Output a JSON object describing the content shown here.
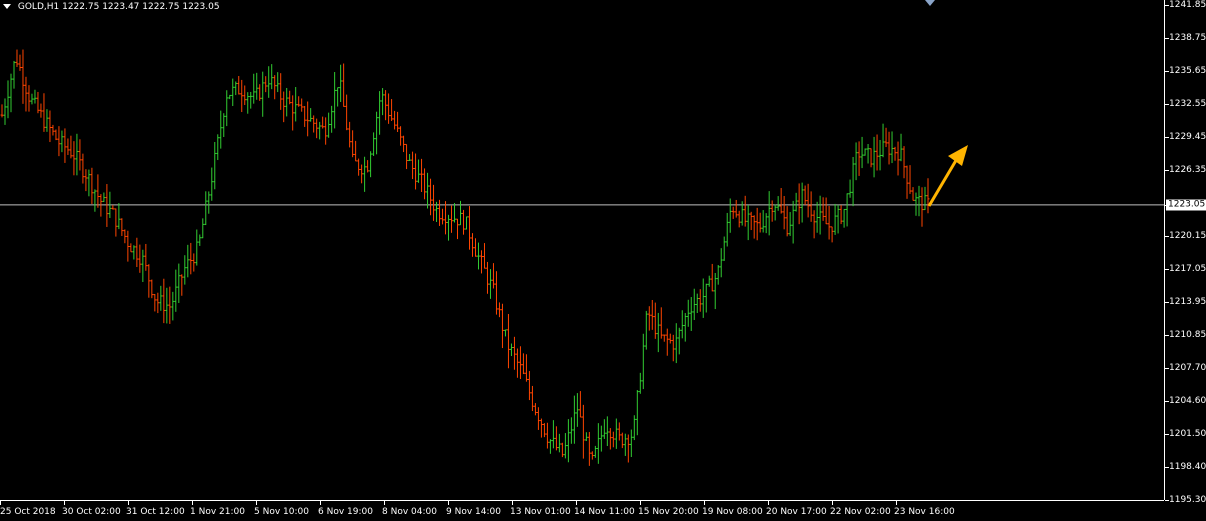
{
  "header": {
    "symbol": "GOLD,H1",
    "ohlc": "1222.75 1223.47 1222.75 1223.05"
  },
  "current_price": "1223.05",
  "colors": {
    "background": "#000000",
    "bull": "#32cd32",
    "bear": "#ff4500",
    "axis": "#ffffff",
    "price_line": "#c0c0c0",
    "arrow": "#ffb400"
  },
  "chart_data": {
    "type": "line",
    "title": "",
    "ylim": [
      1195.3,
      1241.85
    ],
    "y_ticks": [
      "1241.85",
      "1238.75",
      "1235.65",
      "1232.55",
      "1229.45",
      "1226.35",
      "1223.05",
      "1220.15",
      "1217.05",
      "1213.95",
      "1210.85",
      "1207.70",
      "1204.60",
      "1201.50",
      "1198.40",
      "1195.30"
    ],
    "x_ticks": [
      "25 Oct 2018",
      "30 Oct 02:00",
      "31 Oct 12:00",
      "1 Nov 21:00",
      "5 Nov 10:00",
      "6 Nov 19:00",
      "8 Nov 04:00",
      "9 Nov 14:00",
      "13 Nov 01:00",
      "14 Nov 11:00",
      "15 Nov 20:00",
      "19 Nov 08:00",
      "20 Nov 17:00",
      "22 Nov 02:00",
      "23 Nov 16:00"
    ],
    "series": [
      {
        "values": [
          1231.5,
          1237.0,
          1233.0,
          1231.0,
          1229.0,
          1228.0,
          1226.0,
          1223.5,
          1222.0,
          1219.5,
          1218.0,
          1214.0,
          1213.5,
          1217.0,
          1219.0,
          1226.0,
          1233.5,
          1234.0,
          1233.0,
          1235.0,
          1233.0,
          1232.0,
          1231.0,
          1230.0,
          1235.0,
          1227.0,
          1226.5,
          1233.5,
          1230.5,
          1227.0,
          1225.0,
          1222.5,
          1222.0,
          1221.5,
          1218.0,
          1215.0,
          1210.0,
          1207.5,
          1204.0,
          1201.0,
          1199.5,
          1204.0,
          1198.5,
          1202.5,
          1201.0,
          1201.5,
          1213.0,
          1210.5,
          1210.0,
          1213.5,
          1214.5,
          1216.5,
          1223.0,
          1221.5,
          1221.0,
          1223.5,
          1221.0,
          1224.0,
          1222.0,
          1221.0,
          1222.5,
          1228.0,
          1227.5,
          1228.5,
          1228.0,
          1223.5,
          1223.05
        ]
      }
    ],
    "annotation": "up-arrow"
  }
}
